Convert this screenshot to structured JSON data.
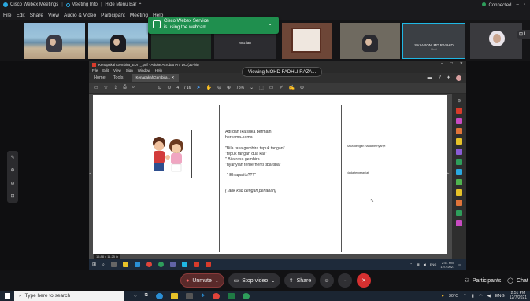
{
  "webex": {
    "title_items": [
      "Cisco Webex Meetings",
      "Meeting Info",
      "Hide Menu Bar"
    ],
    "status": "Connected",
    "menu": [
      "File",
      "Edit",
      "Share",
      "View",
      "Audio & Video",
      "Participant",
      "Meeting",
      "Help"
    ],
    "toast": {
      "line1": "Cisco Webex Service",
      "line2": "is using the webcam"
    },
    "participants": [
      {
        "name": ""
      },
      {
        "name": ""
      },
      {
        "name": ""
      },
      {
        "name": "Muzilan"
      },
      {
        "name": ""
      },
      {
        "name": ""
      },
      {
        "name": "SAZARONI MD RASHID",
        "sub": "Host"
      },
      {
        "name": ""
      }
    ],
    "viewing_label": "Viewing MOHD FADHLI RAZA...",
    "controls": {
      "unmute": "Unmute",
      "stop_video": "Stop video",
      "share": "Share",
      "participants": "Participants",
      "chat": "Chat"
    }
  },
  "acrobat": {
    "title": "KenapakahGembira_EDIT_.pdf - Adobe Acrobat Pro DC (32-bit)",
    "menu": [
      "File",
      "Edit",
      "View",
      "Sign",
      "Window",
      "Help"
    ],
    "tabs": [
      "Home",
      "Tools"
    ],
    "doc_tab": "KenapakahGembira...",
    "page_current": "4",
    "page_total": "/ 16",
    "zoom": "75%",
    "page_size": "15.88 x 11.25 in"
  },
  "document": {
    "lines_main": [
      "Adi dan Ika suka bermain",
      "bersama-sama."
    ],
    "lines_quotes": [
      "\"Bila rasa gembira tepuk tangan\"",
      "\"tepuk tangan dua kali\"",
      "\" Bila rasa gembira......",
      "\"nyanyian terberhenti tiba-tiba\""
    ],
    "line_question": "\" Eh apa itu???\"",
    "line_action": "(Tarik kad dengan perlahan)",
    "note_1": "Baca dengan nada bernyanyi",
    "note_2": "Nada terperanjat"
  },
  "inner_clock": {
    "time": "2:51 PM",
    "date": "12/7/2021"
  },
  "taskbar": {
    "search_placeholder": "Type here to search",
    "weather": "30°C",
    "lang": "ENG",
    "time": "2:51 PM",
    "date": "12/7/2021"
  },
  "colors": {
    "accent_green": "#1f8f4e",
    "end_red": "#d63030",
    "active_tile": "#1fb7e4",
    "pdf_red": "#d83b2b"
  }
}
